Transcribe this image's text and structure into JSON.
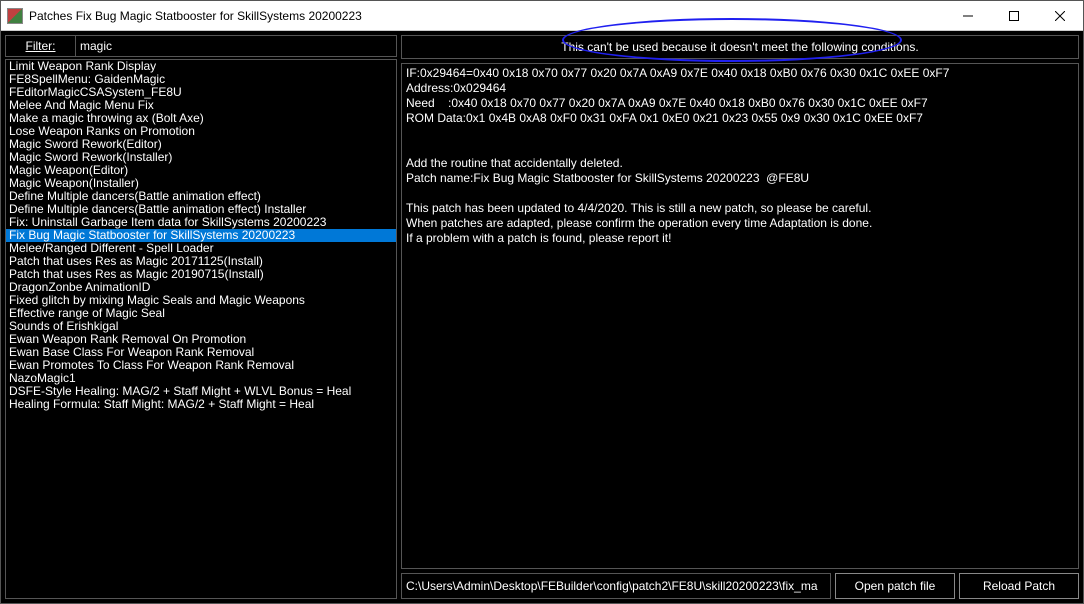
{
  "window": {
    "title": "Patches Fix Bug Magic Statbooster for SkillSystems 20200223"
  },
  "filter": {
    "label": "Filter:",
    "value": "magic"
  },
  "patches": [
    "Limit Weapon Rank Display",
    "FE8SpellMenu: GaidenMagic",
    "FEditorMagicCSASystem_FE8U",
    "Melee And Magic Menu Fix",
    "Make a magic throwing ax (Bolt Axe)",
    "Lose Weapon Ranks on Promotion",
    "Magic Sword Rework(Editor)",
    "Magic Sword Rework(Installer)",
    "Magic Weapon(Editor)",
    "Magic Weapon(Installer)",
    "Define Multiple dancers(Battle animation effect)",
    "Define Multiple dancers(Battle animation effect) Installer",
    "Fix: Uninstall Garbage Item data for SkillSystems 20200223",
    "Fix Bug Magic Statbooster for SkillSystems 20200223",
    "Melee/Ranged Different - Spell Loader",
    "Patch that uses Res as Magic 20171125(Install)",
    "Patch that uses Res as Magic 20190715(Install)",
    "DragonZonbe AnimationID",
    "Fixed glitch by mixing Magic Seals and Magic Weapons",
    "Effective range of Magic Seal",
    "Sounds of Erishkigal",
    "Ewan Weapon Rank Removal On Promotion",
    "Ewan Base Class For Weapon Rank Removal",
    "Ewan Promotes To Class For Weapon Rank Removal",
    "NazoMagic1",
    "DSFE-Style Healing: MAG/2 + Staff Might + WLVL Bonus = Heal",
    "Healing Formula: Staff Might: MAG/2 + Staff Might = Heal"
  ],
  "selected_index": 13,
  "warning": "This can't be used because it doesn't meet the following conditions.",
  "detail": "IF:0x29464=0x40 0x18 0x70 0x77 0x20 0x7A 0xA9 0x7E 0x40 0x18 0xB0 0x76 0x30 0x1C 0xEE 0xF7\nAddress:0x029464\nNeed    :0x40 0x18 0x70 0x77 0x20 0x7A 0xA9 0x7E 0x40 0x18 0xB0 0x76 0x30 0x1C 0xEE 0xF7\nROM Data:0x1 0x4B 0xA8 0xF0 0x31 0xFA 0x1 0xE0 0x21 0x23 0x55 0x9 0x30 0x1C 0xEE 0xF7\n\n\nAdd the routine that accidentally deleted.\nPatch name:Fix Bug Magic Statbooster for SkillSystems 20200223  @FE8U\n\nThis patch has been updated to 4/4/2020. This is still a new patch, so please be careful.\nWhen patches are adapted, please confirm the operation every time Adaptation is done.\nIf a problem with a patch is found, please report it!",
  "path": "C:\\Users\\Admin\\Desktop\\FEBuilder\\config\\patch2\\FE8U\\skill20200223\\fix_ma",
  "buttons": {
    "open": "Open patch file",
    "reload": "Reload Patch"
  }
}
